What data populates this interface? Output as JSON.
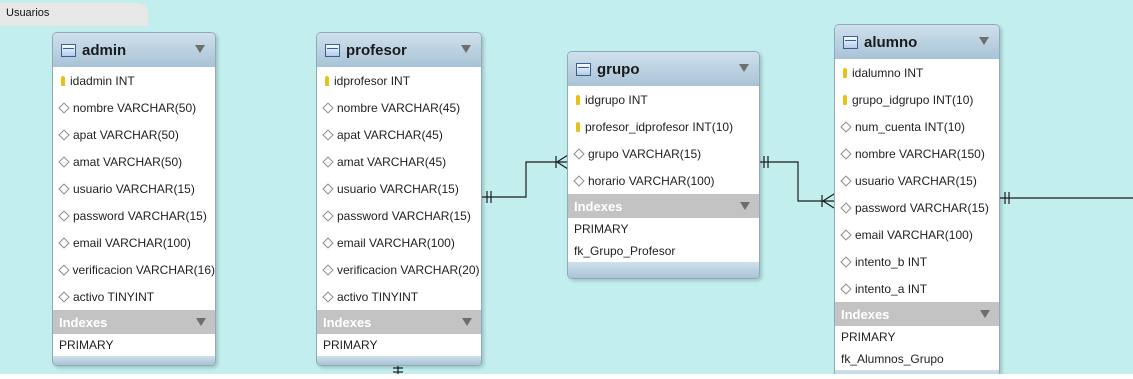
{
  "layer": {
    "name": "Usuarios"
  },
  "tables": {
    "admin": {
      "name": "admin",
      "columns": [
        {
          "label": "idadmin INT",
          "key": true
        },
        {
          "label": "nombre VARCHAR(50)",
          "key": false
        },
        {
          "label": "apat VARCHAR(50)",
          "key": false
        },
        {
          "label": "amat VARCHAR(50)",
          "key": false
        },
        {
          "label": "usuario VARCHAR(15)",
          "key": false
        },
        {
          "label": "password VARCHAR(15)",
          "key": false
        },
        {
          "label": "email VARCHAR(100)",
          "key": false
        },
        {
          "label": "verificacion VARCHAR(16)",
          "key": false
        },
        {
          "label": "activo TINYINT",
          "key": false
        }
      ],
      "indexes_label": "Indexes",
      "indexes": [
        "PRIMARY"
      ]
    },
    "profesor": {
      "name": "profesor",
      "columns": [
        {
          "label": "idprofesor INT",
          "key": true
        },
        {
          "label": "nombre VARCHAR(45)",
          "key": false
        },
        {
          "label": "apat VARCHAR(45)",
          "key": false
        },
        {
          "label": "amat VARCHAR(45)",
          "key": false
        },
        {
          "label": "usuario VARCHAR(15)",
          "key": false
        },
        {
          "label": "password VARCHAR(15)",
          "key": false
        },
        {
          "label": "email VARCHAR(100)",
          "key": false
        },
        {
          "label": "verificacion VARCHAR(20)",
          "key": false
        },
        {
          "label": "activo TINYINT",
          "key": false
        }
      ],
      "indexes_label": "Indexes",
      "indexes": [
        "PRIMARY"
      ]
    },
    "grupo": {
      "name": "grupo",
      "columns": [
        {
          "label": "idgrupo INT",
          "key": true
        },
        {
          "label": "profesor_idprofesor INT(10)",
          "key": true
        },
        {
          "label": "grupo VARCHAR(15)",
          "key": false
        },
        {
          "label": "horario VARCHAR(100)",
          "key": false
        }
      ],
      "indexes_label": "Indexes",
      "indexes": [
        "PRIMARY",
        "fk_Grupo_Profesor"
      ]
    },
    "alumno": {
      "name": "alumno",
      "columns": [
        {
          "label": "idalumno INT",
          "key": true
        },
        {
          "label": "grupo_idgrupo INT(10)",
          "key": true
        },
        {
          "label": "num_cuenta INT(10)",
          "key": false
        },
        {
          "label": "nombre VARCHAR(150)",
          "key": false
        },
        {
          "label": "usuario VARCHAR(15)",
          "key": false
        },
        {
          "label": "password VARCHAR(15)",
          "key": false
        },
        {
          "label": "email VARCHAR(100)",
          "key": false
        },
        {
          "label": "intento_b INT",
          "key": false
        },
        {
          "label": "intento_a INT",
          "key": false
        }
      ],
      "indexes_label": "Indexes",
      "indexes": [
        "PRIMARY",
        "fk_Alumnos_Grupo"
      ]
    }
  }
}
